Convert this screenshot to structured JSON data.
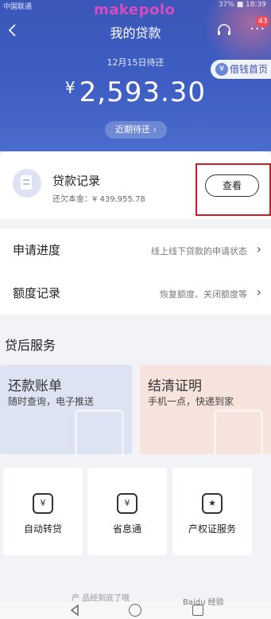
{
  "status_bar": {
    "carrier": "中国联通",
    "right": "37%  ■  18:39"
  },
  "watermark_top": "makepolo",
  "header": {
    "title": "我的贷款",
    "badge": "43",
    "due_date": "12月15日待还",
    "borrow_pill": "借钱首页",
    "amount_currency": "¥",
    "amount": "2,593.30",
    "recent_due": "近期待还 ›"
  },
  "loan_card": {
    "title": "贷款记录",
    "subtitle": "还欠本金：¥ 439,955.78",
    "view_button": "查看"
  },
  "list": [
    {
      "label": "申请进度",
      "hint": "线上线下贷款的申请状态"
    },
    {
      "label": "额度记录",
      "hint": "恢复额度、关闭额度等"
    }
  ],
  "after_loan": {
    "title": "贷后服务",
    "tiles": [
      {
        "title": "还款账单",
        "subtitle": "随时查询，电子推送"
      },
      {
        "title": "结清证明",
        "subtitle": "手机一点，快递到家"
      }
    ],
    "services": [
      {
        "label": "自动转贷",
        "glyph": "¥"
      },
      {
        "label": "省息通",
        "glyph": "¥"
      },
      {
        "label": "产权证服务",
        "glyph": "★"
      }
    ]
  },
  "bottom_text": "产    品经到底了哦",
  "watermark_bottom": "Baidu 经验",
  "icons": {
    "back": "chevron-left-icon",
    "service": "headset-icon",
    "more": "more-dots-icon"
  },
  "colors": {
    "header": "#3f5fc4",
    "highlight": "#c8202a"
  }
}
